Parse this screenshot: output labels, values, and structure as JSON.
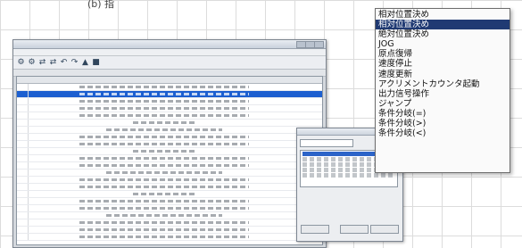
{
  "caption": {
    "text": "(b) 指"
  },
  "toolbar": {
    "icons": [
      "robot-icon",
      "robot-icon",
      "move-icon",
      "move-icon",
      "undo-icon",
      "redo-icon",
      "run-icon",
      "stop-icon"
    ]
  },
  "context_menu": {
    "items": [
      {
        "label": "相对位置決め",
        "selected": false
      },
      {
        "label": "相対位置決め",
        "selected": true
      },
      {
        "label": "絶対位置決め",
        "selected": false
      },
      {
        "label": "JOG",
        "selected": false
      },
      {
        "label": "原点復帰",
        "selected": false
      },
      {
        "label": "速度停止",
        "selected": false
      },
      {
        "label": "速度更新",
        "selected": false
      },
      {
        "label": "アクリメントカウンタ起動",
        "selected": false
      },
      {
        "label": "出力信号操作",
        "selected": false
      },
      {
        "label": "ジャンプ",
        "selected": false
      },
      {
        "label": "条件分岐(=)",
        "selected": false
      },
      {
        "label": "条件分岐(>)",
        "selected": false
      },
      {
        "label": "条件分岐(<)",
        "selected": false
      }
    ]
  }
}
